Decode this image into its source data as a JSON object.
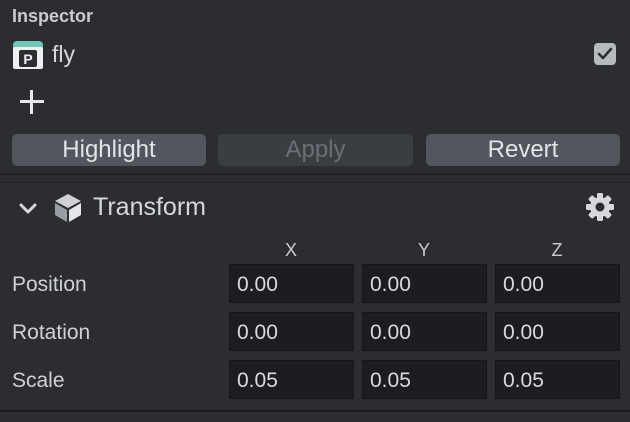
{
  "panel": {
    "title": "Inspector"
  },
  "node": {
    "name": "fly",
    "active": true
  },
  "actions": {
    "highlight": "Highlight",
    "apply": "Apply",
    "revert": "Revert"
  },
  "component": {
    "title": "Transform"
  },
  "axes": {
    "x": "X",
    "y": "Y",
    "z": "Z"
  },
  "properties": {
    "position": {
      "label": "Position",
      "x": "0.00",
      "y": "0.00",
      "z": "0.00"
    },
    "rotation": {
      "label": "Rotation",
      "x": "0.00",
      "y": "0.00",
      "z": "0.00"
    },
    "scale": {
      "label": "Scale",
      "x": "0.05",
      "y": "0.05",
      "z": "0.05"
    }
  },
  "icons": {
    "prefab": "prefab-icon",
    "add": "plus-icon",
    "collapse": "chevron-down-icon",
    "component": "transform-cube-icon",
    "settings": "gear-icon",
    "checkbox": "checkmark-icon"
  },
  "colors": {
    "prefab_accent": "#6fc7b8",
    "panel_bg": "#2b2d31"
  }
}
